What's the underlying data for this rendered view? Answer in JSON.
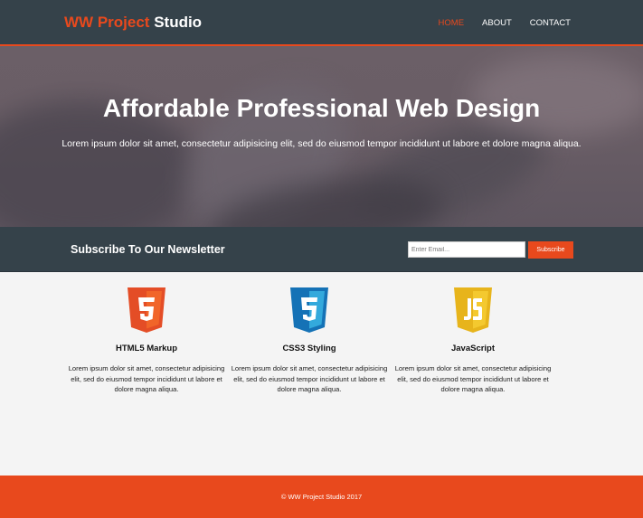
{
  "brand": {
    "highlight": "WW Project",
    "rest": "Studio"
  },
  "nav": {
    "items": [
      "HOME",
      "ABOUT",
      "CONTACT"
    ],
    "active": "HOME"
  },
  "showcase": {
    "title": "Affordable Professional Web Design",
    "text": "Lorem ipsum dolor sit amet, consectetur adipisicing elit, sed do eiusmod tempor incididunt ut labore et dolore magna aliqua."
  },
  "newsletter": {
    "title": "Subscribe To Our Newsletter",
    "email_placeholder": "Enter Email...",
    "button": "Subscribe"
  },
  "boxes": [
    {
      "icon": "html5-icon",
      "title": "HTML5 Markup",
      "text": "Lorem ipsum dolor sit amet, consectetur adipisicing elit, sed do eiusmod tempor incididunt ut labore et dolore magna aliqua."
    },
    {
      "icon": "css3-icon",
      "title": "CSS3 Styling",
      "text": "Lorem ipsum dolor sit amet, consectetur adipisicing elit, sed do eiusmod tempor incididunt ut labore et dolore magna aliqua."
    },
    {
      "icon": "javascript-icon",
      "title": "JavaScript",
      "text": "Lorem ipsum dolor sit amet, consectetur adipisicing elit, sed do eiusmod tempor incididunt ut labore et dolore magna aliqua."
    }
  ],
  "footer": {
    "text": "© WW Project Studio 2017"
  },
  "colors": {
    "header": "#35424a",
    "accent": "#e8491d",
    "background": "#f4f4f4"
  }
}
